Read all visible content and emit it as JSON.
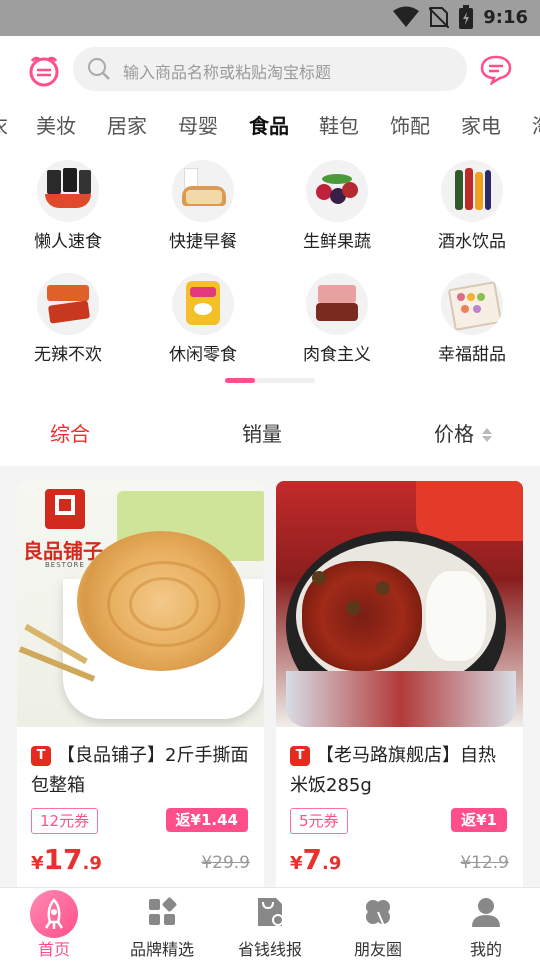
{
  "status_bar": {
    "time": "9:16",
    "icons": [
      "wifi-icon",
      "no-sim-icon",
      "battery-icon"
    ]
  },
  "search": {
    "placeholder": "输入商品名称或粘贴淘宝标题"
  },
  "categories": [
    "衣",
    "美妆",
    "居家",
    "母婴",
    "食品",
    "鞋包",
    "饰配",
    "家电",
    "淘"
  ],
  "active_category": "食品",
  "subcategories": [
    {
      "label": "懒人速食",
      "icon": "instant-food-icon"
    },
    {
      "label": "快捷早餐",
      "icon": "bread-icon"
    },
    {
      "label": "生鲜果蔬",
      "icon": "berries-icon"
    },
    {
      "label": "酒水饮品",
      "icon": "drinks-icon"
    },
    {
      "label": "无辣不欢",
      "icon": "spicy-snack-icon"
    },
    {
      "label": "休闲零食",
      "icon": "snack-bag-icon"
    },
    {
      "label": "肉食主义",
      "icon": "meat-icon"
    },
    {
      "label": "幸福甜品",
      "icon": "dessert-icon"
    }
  ],
  "sort_options": [
    "综合",
    "销量",
    "价格"
  ],
  "active_sort": "综合",
  "products": [
    {
      "shop_badge": "T",
      "title": "【良品铺子】2斤手撕面包整箱",
      "coupon": "12元券",
      "rebate": "返¥1.44",
      "price_currency": "¥",
      "price_int": "17",
      "price_dec": ".9",
      "original_price": "¥29.9",
      "image_brand_text": "良品铺子",
      "image_brand_sub": "BESTORE"
    },
    {
      "shop_badge": "T",
      "title": "【老马路旗舰店】自热米饭285g",
      "coupon": "5元券",
      "rebate": "返¥1",
      "price_currency": "¥",
      "price_int": "7",
      "price_dec": ".9",
      "original_price": "¥12.9"
    }
  ],
  "tab_bar": [
    {
      "label": "首页",
      "icon": "rocket-icon",
      "active": true
    },
    {
      "label": "品牌精选",
      "icon": "grid-icon"
    },
    {
      "label": "省钱线报",
      "icon": "document-icon"
    },
    {
      "label": "朋友圈",
      "icon": "clover-icon"
    },
    {
      "label": "我的",
      "icon": "user-icon"
    }
  ],
  "colors": {
    "accent": "#ff4f8b",
    "price_red": "#e8312f",
    "status_bar": "#9e9e9e"
  }
}
